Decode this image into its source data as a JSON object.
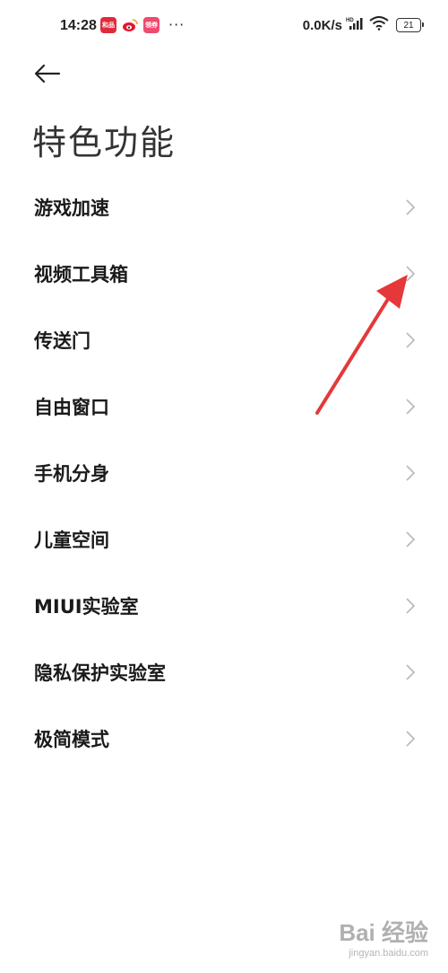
{
  "status_bar": {
    "time": "14:28",
    "notif_red_label": "和品",
    "notif_pink_label": "领券",
    "more_dots": "···",
    "net_speed": "0.0K/s",
    "battery_level": "21"
  },
  "header": {
    "title": "特色功能"
  },
  "menu": {
    "items": [
      {
        "label": "游戏加速"
      },
      {
        "label": "视频工具箱"
      },
      {
        "label": "传送门"
      },
      {
        "label": "自由窗口"
      },
      {
        "label": "手机分身"
      },
      {
        "label": "儿童空间"
      },
      {
        "label": "MIUI实验室"
      },
      {
        "label": "隐私保护实验室"
      },
      {
        "label": "极简模式"
      }
    ]
  },
  "watermark": {
    "logo": "Bai 经验",
    "url": "jingyan.baidu.com"
  },
  "colors": {
    "annotation_arrow": "#e5383b",
    "chevron": "#b8b8b8"
  }
}
